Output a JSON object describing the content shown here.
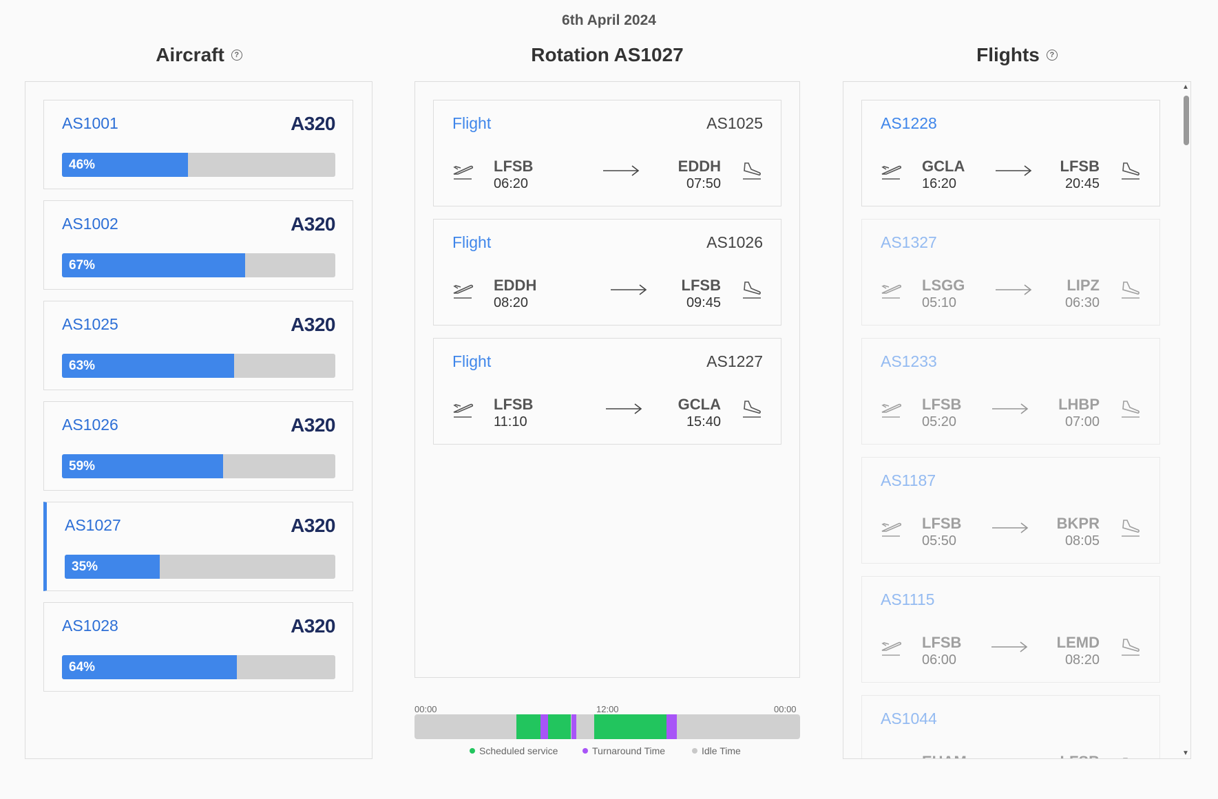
{
  "date": "6th April 2024",
  "aircraft_panel": {
    "title": "Aircraft",
    "items": [
      {
        "id": "AS1001",
        "type": "A320",
        "usage": "46%",
        "pct": 46,
        "selected": false
      },
      {
        "id": "AS1002",
        "type": "A320",
        "usage": "67%",
        "pct": 67,
        "selected": false
      },
      {
        "id": "AS1025",
        "type": "A320",
        "usage": "63%",
        "pct": 63,
        "selected": false
      },
      {
        "id": "AS1026",
        "type": "A320",
        "usage": "59%",
        "pct": 59,
        "selected": false
      },
      {
        "id": "AS1027",
        "type": "A320",
        "usage": "35%",
        "pct": 35,
        "selected": true
      },
      {
        "id": "AS1028",
        "type": "A320",
        "usage": "64%",
        "pct": 64,
        "selected": false
      }
    ]
  },
  "rotation_panel": {
    "title": "Rotation AS1027",
    "flights": [
      {
        "label": "Flight",
        "number": "AS1025",
        "from": "LFSB",
        "dep": "06:20",
        "to": "EDDH",
        "arr": "07:50"
      },
      {
        "label": "Flight",
        "number": "AS1026",
        "from": "EDDH",
        "dep": "08:20",
        "to": "LFSB",
        "arr": "09:45"
      },
      {
        "label": "Flight",
        "number": "AS1227",
        "from": "LFSB",
        "dep": "11:10",
        "to": "GCLA",
        "arr": "15:40"
      }
    ]
  },
  "flights_panel": {
    "title": "Flights",
    "items": [
      {
        "number": "AS1228",
        "from": "GCLA",
        "dep": "16:20",
        "to": "LFSB",
        "arr": "20:45",
        "active": true
      },
      {
        "number": "AS1327",
        "from": "LSGG",
        "dep": "05:10",
        "to": "LIPZ",
        "arr": "06:30",
        "active": false
      },
      {
        "number": "AS1233",
        "from": "LFSB",
        "dep": "05:20",
        "to": "LHBP",
        "arr": "07:00",
        "active": false
      },
      {
        "number": "AS1187",
        "from": "LFSB",
        "dep": "05:50",
        "to": "BKPR",
        "arr": "08:05",
        "active": false
      },
      {
        "number": "AS1115",
        "from": "LFSB",
        "dep": "06:00",
        "to": "LEMD",
        "arr": "08:20",
        "active": false
      },
      {
        "number": "AS1044",
        "from": "EHAM",
        "dep": "",
        "to": "LFSB",
        "arr": "",
        "active": false
      }
    ]
  },
  "timeline": {
    "ticks": [
      "00:00",
      "12:00",
      "00:00"
    ],
    "segments": [
      {
        "kind": "service",
        "start": "06:20",
        "end": "07:50"
      },
      {
        "kind": "turnaround",
        "start": "07:50",
        "end": "08:20"
      },
      {
        "kind": "service",
        "start": "08:20",
        "end": "09:45"
      },
      {
        "kind": "turnaround",
        "start": "09:45",
        "end": "10:05"
      },
      {
        "kind": "service",
        "start": "11:10",
        "end": "15:40"
      },
      {
        "kind": "turnaround",
        "start": "15:40",
        "end": "16:20"
      }
    ],
    "legend": [
      "Scheduled service",
      "Turnaround Time",
      "Idle Time"
    ],
    "colors": {
      "service": "#22c55e",
      "turnaround": "#a855f7",
      "idle": "#d0d0d0"
    }
  }
}
